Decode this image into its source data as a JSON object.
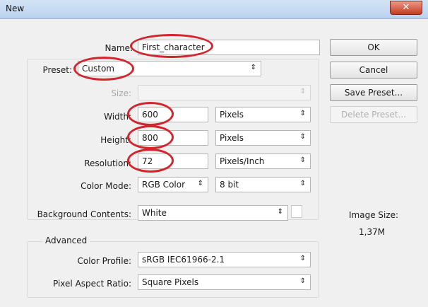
{
  "window": {
    "title": "New",
    "close_icon": "close-icon"
  },
  "name": {
    "label": "Name:",
    "value": "First_character"
  },
  "preset": {
    "label": "Preset:",
    "value": "Custom"
  },
  "size": {
    "label": "Size:",
    "value": ""
  },
  "width": {
    "label": "Width:",
    "value": "600",
    "unit": "Pixels"
  },
  "height": {
    "label": "Height:",
    "value": "800",
    "unit": "Pixels"
  },
  "resolution": {
    "label": "Resolution:",
    "value": "72",
    "unit": "Pixels/Inch"
  },
  "color_mode": {
    "label": "Color Mode:",
    "value": "RGB Color",
    "depth": "8 bit"
  },
  "background": {
    "label": "Background Contents:",
    "value": "White"
  },
  "advanced": {
    "title": "Advanced",
    "color_profile_label": "Color Profile:",
    "color_profile_value": "sRGB IEC61966-2.1",
    "pixel_aspect_label": "Pixel Aspect Ratio:",
    "pixel_aspect_value": "Square Pixels"
  },
  "buttons": {
    "ok": "OK",
    "cancel": "Cancel",
    "save_preset": "Save Preset...",
    "delete_preset": "Delete Preset..."
  },
  "image_size": {
    "label": "Image Size:",
    "value": "1,37M"
  },
  "colors": {
    "annotation": "#d4252c",
    "title_bar": "#c8dcf2",
    "close_button": "#c73a1f"
  }
}
